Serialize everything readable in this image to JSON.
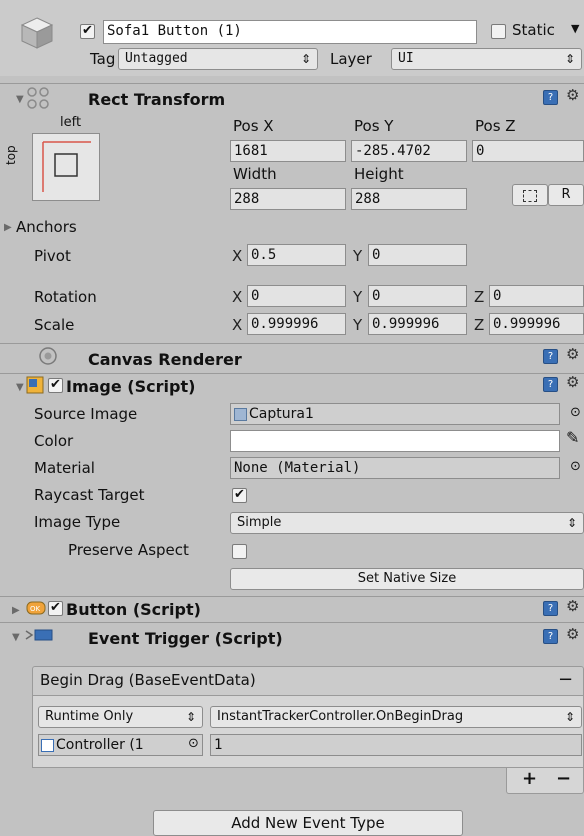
{
  "gameobject": {
    "active": true,
    "name": "Sofa1 Button (1)",
    "static_label": "Static",
    "tag_label": "Tag",
    "tag_value": "Untagged",
    "layer_label": "Layer",
    "layer_value": "UI"
  },
  "rect_transform": {
    "title": "Rect Transform",
    "anchor_h": "left",
    "anchor_v": "top",
    "pos_x_label": "Pos X",
    "pos_y_label": "Pos Y",
    "pos_z_label": "Pos Z",
    "pos_x": "1681",
    "pos_y": "-285.4702",
    "pos_z": "0",
    "width_label": "Width",
    "height_label": "Height",
    "width": "288",
    "height": "288",
    "raw_edit_label": "R",
    "anchors_label": "Anchors",
    "pivot_label": "Pivot",
    "pivot_x": "0.5",
    "pivot_y": "0",
    "rotation_label": "Rotation",
    "rotation_x": "0",
    "rotation_y": "0",
    "rotation_z": "0",
    "scale_label": "Scale",
    "scale_x": "0.999996",
    "scale_y": "0.999996",
    "scale_z": "0.999996",
    "axis_x": "X",
    "axis_y": "Y",
    "axis_z": "Z"
  },
  "canvas_renderer": {
    "title": "Canvas Renderer"
  },
  "image_script": {
    "enabled": true,
    "title": "Image (Script)",
    "source_image_label": "Source Image",
    "source_image_value": "Captura1",
    "color_label": "Color",
    "color_value": "#ffffff",
    "material_label": "Material",
    "material_value": "None (Material)",
    "raycast_label": "Raycast Target",
    "raycast_checked": true,
    "image_type_label": "Image Type",
    "image_type_value": "Simple",
    "preserve_aspect_label": "Preserve Aspect",
    "preserve_aspect_checked": false,
    "set_native_size_label": "Set Native Size"
  },
  "button_script": {
    "enabled": true,
    "title": "Button (Script)"
  },
  "event_trigger": {
    "title": "Event Trigger (Script)",
    "event_name": "Begin Drag (BaseEventData)",
    "remove_symbol": "−",
    "runtime_value": "Runtime Only",
    "function_value": "InstantTrackerController.OnBeginDrag",
    "object_value": "Controller (1",
    "argument_value": "1",
    "add_symbol": "+",
    "minus_symbol": "−",
    "add_event_label": "Add New Event Type"
  },
  "colors": {
    "accent": "#3a6fb5",
    "panel": "#c2c2c2",
    "header": "#cbcbcb"
  }
}
